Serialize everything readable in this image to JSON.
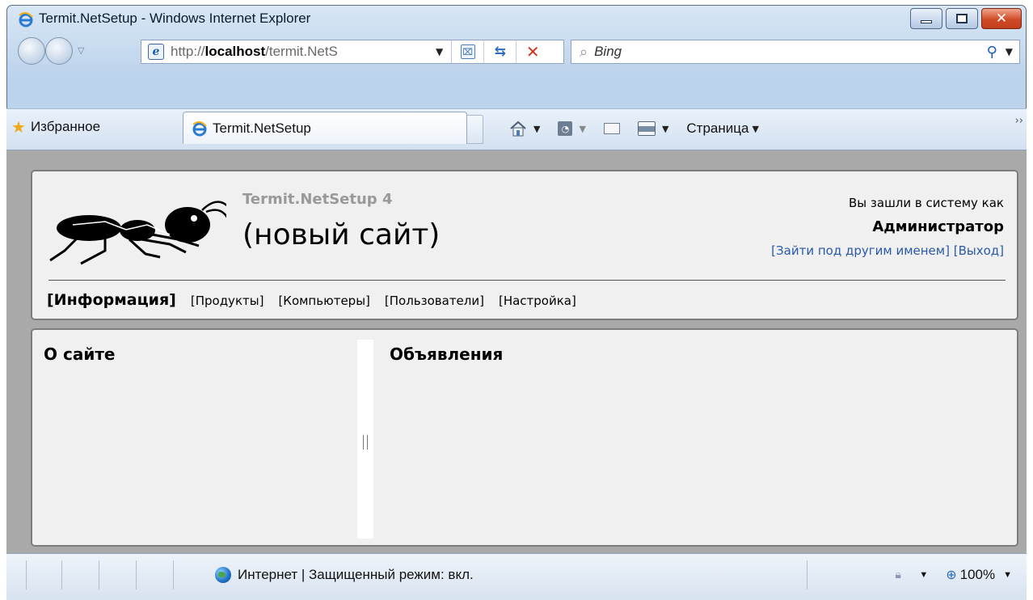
{
  "window": {
    "title": "Termit.NetSetup - Windows Internet Explorer"
  },
  "toolbar": {
    "address_prefix": "http://",
    "address_host": "localhost",
    "address_path": "/termit.NetS",
    "search_placeholder": "Bing",
    "favorites_label": "Избранное",
    "page_menu_label": "Страница"
  },
  "tab": {
    "label": "Termit.NetSetup"
  },
  "header": {
    "site_small_title": "Termit.NetSetup 4",
    "site_big_title": "(новый сайт)",
    "login_prefix": "Вы зашли в систему как",
    "login_user": "Администратор",
    "switch_user_link": "[Зайти под другим именем]",
    "logout_link": "[Выход]"
  },
  "menu": {
    "items": [
      {
        "label": "[Информация]",
        "active": true
      },
      {
        "label": "[Продукты]",
        "active": false
      },
      {
        "label": "[Компьютеры]",
        "active": false
      },
      {
        "label": "[Пользователи]",
        "active": false
      },
      {
        "label": "[Настройка]",
        "active": false
      }
    ]
  },
  "body": {
    "left_title": "О сайте",
    "right_title": "Объявления"
  },
  "statusbar": {
    "zone_text": "Интернет | Защищенный режим: вкл.",
    "zoom": "100%"
  },
  "colors": {
    "link": "#2a58a8",
    "panel_bg": "#f0f0f0",
    "close_button": "#c33f1c"
  }
}
